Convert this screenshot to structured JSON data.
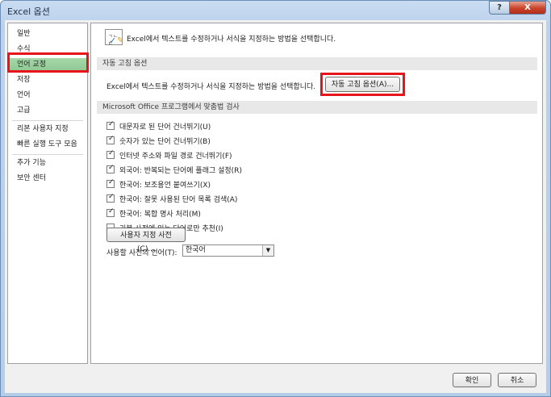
{
  "window": {
    "title": "Excel 옵션",
    "help_label": "?",
    "close_label": "X"
  },
  "sidebar": {
    "items": [
      {
        "label": "일반"
      },
      {
        "label": "수식"
      },
      {
        "label": "언어 교정"
      },
      {
        "label": "저장"
      },
      {
        "label": "언어"
      },
      {
        "label": "고급"
      },
      {
        "label": "리본 사용자 지정"
      },
      {
        "label": "빠른 실행 도구 모음"
      },
      {
        "label": "추가 기능"
      },
      {
        "label": "보안 센터"
      }
    ],
    "selected_index": 2
  },
  "header": {
    "text": "Excel에서 텍스트를 수정하거나 서식을 지정하는 방법을 선택합니다."
  },
  "autocorrect": {
    "section_title": "자동 고침 옵션",
    "description": "Excel에서 텍스트를 수정하거나 서식을 지정하는 방법을 선택합니다.",
    "button_label": "자동 고침 옵션(A)..."
  },
  "spelling": {
    "section_title": "Microsoft Office 프로그램에서 맞춤법 검사",
    "options": [
      {
        "label": "대문자로 된 단어 건너뛰기(U)",
        "checked": true
      },
      {
        "label": "숫자가 있는 단어 건너뛰기(B)",
        "checked": true
      },
      {
        "label": "인터넷 주소와 파일 경로 건너뛰기(F)",
        "checked": true
      },
      {
        "label": "외국어: 반복되는 단어에 플래그 설정(R)",
        "checked": true
      },
      {
        "label": "한국어: 보조용언 붙여쓰기(X)",
        "checked": true
      },
      {
        "label": "한국어: 잘못 사용된 단어 목록 검색(A)",
        "checked": true
      },
      {
        "label": "한국어: 복합 명사 처리(M)",
        "checked": true
      },
      {
        "label": "기본 사전에 있는 단어로만 추천(I)",
        "checked": false
      }
    ],
    "custom_dict_button": "사용자 지정 사전(C)...",
    "dict_language_label": "사용할 사전의 언어(T):",
    "dict_language_value": "한국어"
  },
  "footer": {
    "ok_label": "확인",
    "cancel_label": "취소"
  }
}
